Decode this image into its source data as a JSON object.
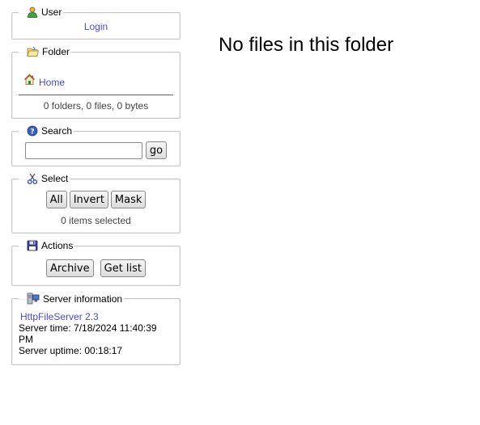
{
  "user": {
    "legend": "User",
    "icon": "user-icon",
    "login_label": "Login"
  },
  "folder": {
    "legend": "Folder",
    "icon": "folder-icon",
    "home_label": "Home",
    "home_icon": "home-icon",
    "stats": "0 folders, 0 files, 0 bytes"
  },
  "search": {
    "legend": "Search",
    "icon": "help-icon",
    "input_value": "",
    "go_label": "go"
  },
  "select": {
    "legend": "Select",
    "icon": "scissors-icon",
    "all_label": "All",
    "invert_label": "Invert",
    "mask_label": "Mask",
    "count": "0 items selected"
  },
  "actions": {
    "legend": "Actions",
    "icon": "floppy-disk-icon",
    "archive_label": "Archive",
    "getlist_label": "Get list"
  },
  "server": {
    "legend": "Server information",
    "icon": "server-icon",
    "version_link": "HttpFileServer 2.3",
    "time": "Server time: 7/18/2024 11:40:39 PM",
    "uptime": "Server uptime: 00:18:17"
  },
  "main": {
    "message": "No files in this folder"
  },
  "colors": {
    "link": "#4a4ad9",
    "border": "#c8c8c8"
  }
}
